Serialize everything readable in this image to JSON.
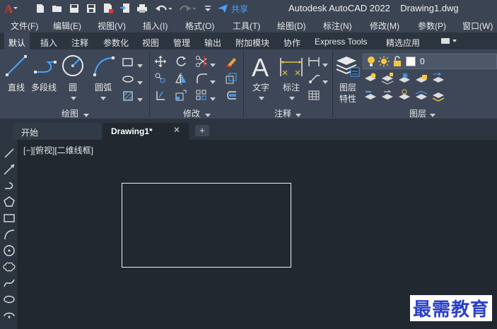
{
  "titlebar": {
    "app_title": "Autodesk AutoCAD 2022",
    "document_name": "Drawing1.dwg",
    "share_label": "共享"
  },
  "menubar": {
    "items": [
      "文件(F)",
      "编辑(E)",
      "视图(V)",
      "插入(I)",
      "格式(O)",
      "工具(T)",
      "绘图(D)",
      "标注(N)",
      "修改(M)",
      "参数(P)",
      "窗口(W)"
    ]
  },
  "ribbon_tabs": {
    "items": [
      "默认",
      "插入",
      "注释",
      "参数化",
      "视图",
      "管理",
      "输出",
      "附加模块",
      "协作",
      "Express Tools",
      "精选应用"
    ],
    "active": "默认"
  },
  "ribbon": {
    "draw": {
      "title": "绘图",
      "line": "直线",
      "polyline": "多段线",
      "circle": "圆",
      "arc": "圆弧"
    },
    "modify": {
      "title": "修改"
    },
    "annotation": {
      "title": "注释",
      "text": "文字",
      "dimension": "标注"
    },
    "layers": {
      "title": "图层",
      "layer_properties_line1": "图层",
      "layer_properties_line2": "特性",
      "current_layer": "0"
    }
  },
  "doc_tabs": {
    "start": "开始",
    "drawing": "Drawing1*",
    "close": "✕",
    "add": "+"
  },
  "viewport": {
    "label": "[−][俯视][二维线框]"
  },
  "watermark": {
    "text": "最需教育"
  },
  "colors": {
    "title_bg": "#3b4453",
    "ribbon_bg": "#3d4757",
    "canvas_bg": "#212830",
    "accent_blue": "#4aa3ff",
    "autocad_red": "#d23b2a",
    "watermark_blue": "#2a3fc9"
  }
}
